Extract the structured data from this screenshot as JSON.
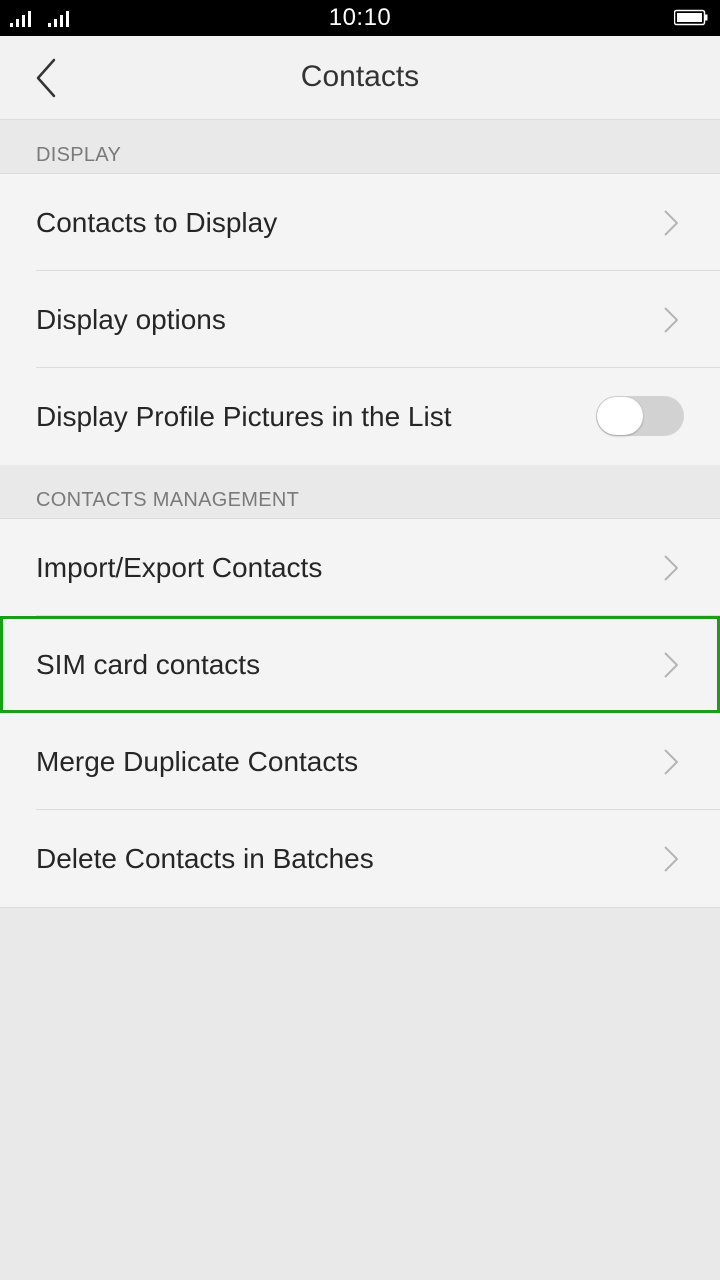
{
  "status_bar": {
    "time": "10:10"
  },
  "header": {
    "title": "Contacts",
    "back_icon": "chevron-left-icon"
  },
  "sections": [
    {
      "title": "DISPLAY",
      "items": [
        {
          "label": "Contacts to Display",
          "control": "chevron-right-icon"
        },
        {
          "label": "Display options",
          "control": "chevron-right-icon"
        },
        {
          "label": "Display Profile Pictures in the List",
          "control": "toggle",
          "toggle_on": false
        }
      ]
    },
    {
      "title": "CONTACTS MANAGEMENT",
      "items": [
        {
          "label": "Import/Export Contacts",
          "control": "chevron-right-icon"
        },
        {
          "label": "SIM card contacts",
          "control": "chevron-right-icon",
          "highlighted": true
        },
        {
          "label": "Merge Duplicate Contacts",
          "control": "chevron-right-icon"
        },
        {
          "label": "Delete Contacts in Batches",
          "control": "chevron-right-icon"
        }
      ]
    }
  ],
  "colors": {
    "highlight": "#1a9e1a",
    "toggle_off": "#d2d2d2",
    "background": "#e9e9e9",
    "row_background": "#f4f4f4"
  }
}
